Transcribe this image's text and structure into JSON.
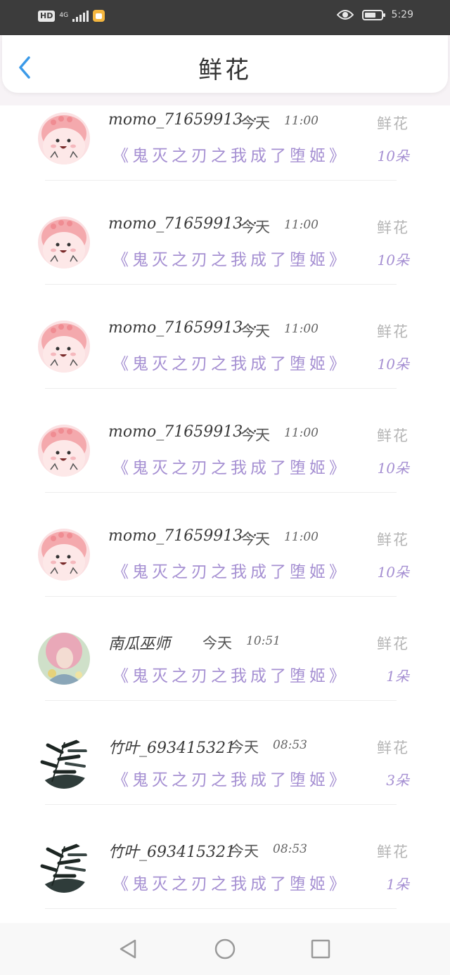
{
  "status_bar": {
    "hd": "HD",
    "network": "4G",
    "time": "5:29",
    "icons": [
      "signal-icon",
      "app-notification-icon",
      "eye-icon",
      "battery-icon"
    ]
  },
  "header": {
    "title": "鲜花",
    "back_icon": "chevron-left-icon",
    "accent_color": "#3b9ae8"
  },
  "records": [
    {
      "user": "momo_71659913···",
      "day": "今天",
      "time": "11:00",
      "book": "《鬼灭之刃之我成了堕姬》",
      "gift": "鲜花",
      "count": "10朵",
      "avatar": "pink-bear"
    },
    {
      "user": "momo_71659913···",
      "day": "今天",
      "time": "11:00",
      "book": "《鬼灭之刃之我成了堕姬》",
      "gift": "鲜花",
      "count": "10朵",
      "avatar": "pink-bear"
    },
    {
      "user": "momo_71659913···",
      "day": "今天",
      "time": "11:00",
      "book": "《鬼灭之刃之我成了堕姬》",
      "gift": "鲜花",
      "count": "10朵",
      "avatar": "pink-bear"
    },
    {
      "user": "momo_71659913···",
      "day": "今天",
      "time": "11:00",
      "book": "《鬼灭之刃之我成了堕姬》",
      "gift": "鲜花",
      "count": "10朵",
      "avatar": "pink-bear"
    },
    {
      "user": "momo_71659913···",
      "day": "今天",
      "time": "11:00",
      "book": "《鬼灭之刃之我成了堕姬》",
      "gift": "鲜花",
      "count": "10朵",
      "avatar": "pink-bear"
    },
    {
      "user": "南瓜巫师",
      "day": "今天",
      "time": "10:51",
      "book": "《鬼灭之刃之我成了堕姬》",
      "gift": "鲜花",
      "count": "1朵",
      "avatar": "portrait"
    },
    {
      "user": "竹叶_693415321",
      "day": "今天",
      "time": "08:53",
      "book": "《鬼灭之刃之我成了堕姬》",
      "gift": "鲜花",
      "count": "3朵",
      "avatar": "bamboo"
    },
    {
      "user": "竹叶_693415321",
      "day": "今天",
      "time": "08:53",
      "book": "《鬼灭之刃之我成了堕姬》",
      "gift": "鲜花",
      "count": "1朵",
      "avatar": "bamboo"
    }
  ],
  "nav_bar": {
    "icons": [
      "back-triangle-icon",
      "home-circle-icon",
      "recents-square-icon"
    ]
  },
  "colors": {
    "book_title": "#a58fd2",
    "gift_label": "#b5b5b5",
    "status_bar_bg": "#3c3c3c"
  }
}
